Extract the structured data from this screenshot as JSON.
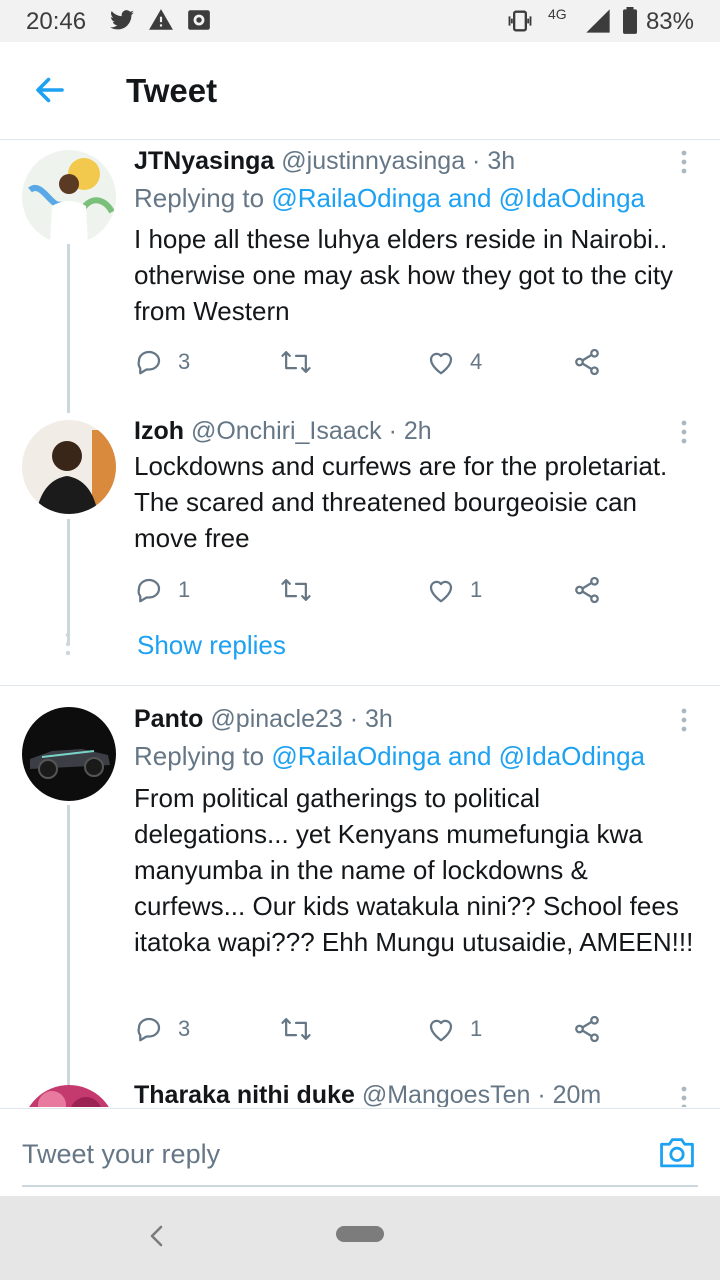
{
  "status_bar": {
    "time": "20:46",
    "network": "4G",
    "battery": "83%",
    "icons": [
      "twitter-icon",
      "warning-icon",
      "screenshot-icon",
      "vibrate-icon",
      "signal-icon",
      "battery-icon"
    ]
  },
  "header": {
    "title": "Tweet",
    "back_icon": "arrow-left-icon"
  },
  "tweets": [
    {
      "name": "JTNyasinga",
      "meta": "@justinnyasinga · 3h",
      "replying_prefix": "Replying to ",
      "replying_link": "@RailaOdinga and @IdaOdinga",
      "text": "I hope all these luhya elders reside in Nairobi.. otherwise one may ask how they got to the city from Western",
      "replies": "3",
      "retweets": "",
      "likes": "4"
    },
    {
      "name": "Izoh",
      "meta": "@Onchiri_Isaack · 2h",
      "text": "Lockdowns and curfews are for the proletariat. The scared and threatened bourgeoisie can move free",
      "replies": "1",
      "retweets": "",
      "likes": "1",
      "show_replies": "Show replies"
    },
    {
      "name": "Panto",
      "meta": "@pinacle23 · 3h",
      "replying_prefix": "Replying to ",
      "replying_link": "@RailaOdinga and @IdaOdinga",
      "text": "From political gatherings to political delegations... yet Kenyans mumefungia kwa manyumba in the name of lockdowns & curfews... Our kids watakula nini?? School fees itatoka wapi??? Ehh Mungu utusaidie, AMEEN!!!",
      "replies": "3",
      "retweets": "",
      "likes": "1"
    },
    {
      "name": "Tharaka nithi duke",
      "meta": "@MangoesTen · 20m"
    }
  ],
  "reply_bar": {
    "placeholder": "Tweet your reply",
    "camera_icon": "camera-icon"
  },
  "colors": {
    "accent": "#1da1f2",
    "text": "#14171a",
    "muted": "#657786",
    "divider": "#e1e8ed"
  }
}
